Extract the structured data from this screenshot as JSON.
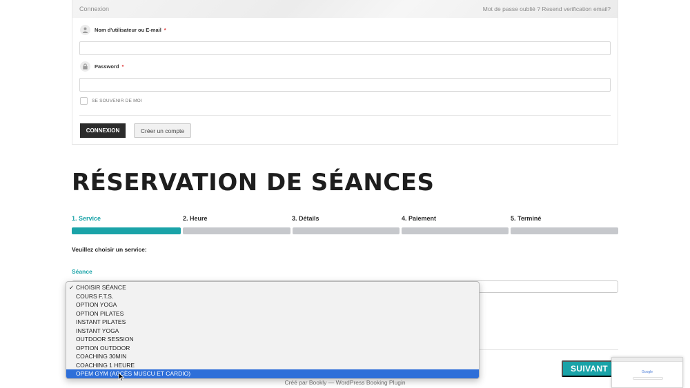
{
  "login": {
    "header_title": "Connexion",
    "header_links": "Mot de passe oublié ? Resend verification email?",
    "username_label": "Nom d'utilisateur ou E-mail",
    "username_value": "",
    "password_label": "Password",
    "password_value": "",
    "required_marker": "*",
    "remember_label": "SE SOUVENIR DE MOI",
    "login_button": "CONNEXION",
    "create_account_button": "Créer un compte"
  },
  "page_title": "RÉSERVATION DE SÉANCES",
  "steps": [
    {
      "label": "1. Service",
      "active": true
    },
    {
      "label": "2. Heure",
      "active": false
    },
    {
      "label": "3. Détails",
      "active": false
    },
    {
      "label": "4. Paiement",
      "active": false
    },
    {
      "label": "5. Terminé",
      "active": false
    }
  ],
  "service": {
    "prompt": "Veuillez choisir un service:",
    "seance_label": "Séance",
    "selected": "CHOISIR SÉANCE",
    "options": [
      "CHOISIR SÉANCE",
      "COURS F.T.S.",
      "OPTION YOGA",
      "OPTION PILATES",
      "INSTANT PILATES",
      "INSTANT YOGA",
      "OUTDOOR SESSION",
      "OPTION OUTDOOR",
      "COACHING 30MIN",
      "COACHING 1 HEURE",
      "OPEM GYM (ACCÈS MUSCU ET CARDIO)"
    ],
    "checked_index": 0,
    "highlighted_index": 10,
    "check_glyph": "✓"
  },
  "next_button": "SUIVANT",
  "credit": "Créé par Bookly — WordPress Booking Plugin",
  "thumbnail": {
    "text": "Google"
  },
  "colors": {
    "accent": "#1aa3a8",
    "highlight": "#2e6fd9",
    "step_inactive": "#c6c8cc"
  }
}
